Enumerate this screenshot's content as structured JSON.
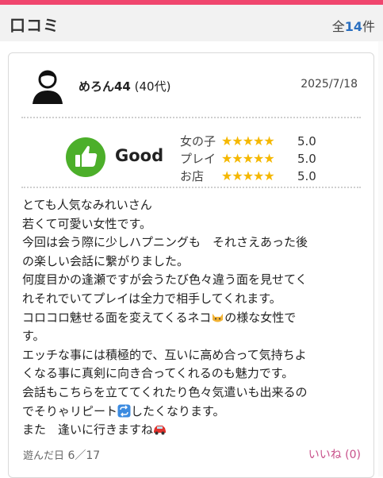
{
  "header": {
    "title": "口コミ",
    "count_prefix": "全",
    "count_number": "14",
    "count_suffix": "件"
  },
  "review": {
    "user_name": "めろん44",
    "user_age": "(40代)",
    "date": "2025/7/18",
    "verdict": "Good",
    "ratings": [
      {
        "label": "女の子",
        "stars": 5,
        "score": "5.0"
      },
      {
        "label": "プレイ",
        "stars": 5,
        "score": "5.0"
      },
      {
        "label": "お店",
        "stars": 5,
        "score": "5.0"
      }
    ],
    "body_lines": [
      "とても人気なみれいさん",
      "若くて可愛い女性です。",
      "今回は会う際に少しハプニングも　それさえあった後",
      "の楽しい会話に繋がりました。",
      "何度目かの逢瀬ですが会うたび色々違う面を見せてく",
      "れそれでいてプレイは全力で相手してくれます。",
      "コロコロ魅せる面を変えてくるネコ",
      "の様な女性で",
      "す。",
      "エッチな事には積極的で、互いに高め合って気持ちよ",
      "くなる事に真剣に向き合ってくれるのも魅力です。",
      "会話もこちらを立ててくれたり色々気遣いも出来るの",
      "でそりゃリピート",
      "したくなります。",
      "また　逢いに行きますね"
    ],
    "visited_label": "遊んだ日",
    "visited_date": "6／17",
    "like_label": "いいね",
    "like_count": "(0)"
  },
  "icons": {
    "avatar": "user-silhouette-icon",
    "verdict": "thumbs-up-icon",
    "star": "star-icon",
    "emoji_cat": "cat-face-icon",
    "emoji_repeat": "repeat-icon",
    "emoji_car": "car-icon"
  },
  "colors": {
    "brand_pink": "#f0466e",
    "verdict_green": "#4caf2a",
    "star_gold": "#f5b800",
    "count_blue": "#2a6fc0",
    "like_pink": "#c8508a"
  }
}
